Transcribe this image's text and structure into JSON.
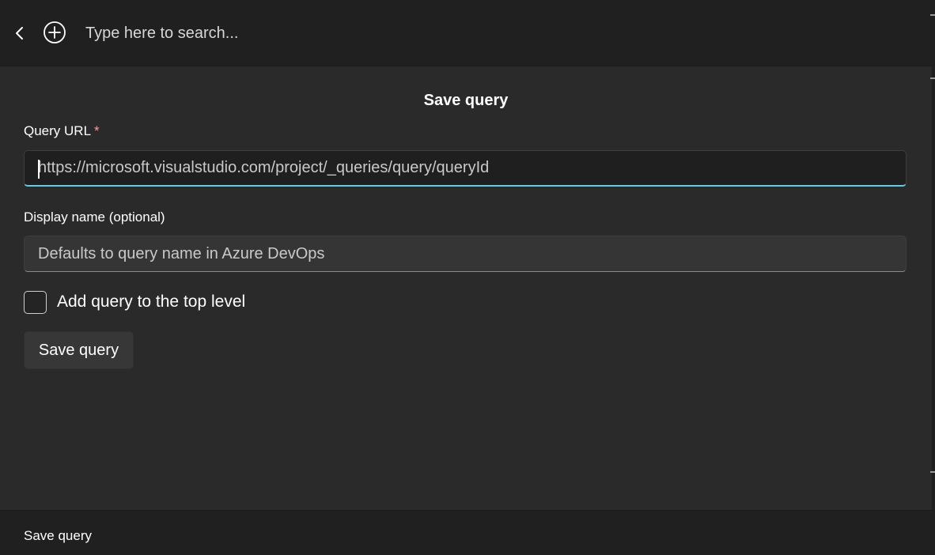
{
  "header": {
    "search_placeholder": "Type here to search..."
  },
  "panel": {
    "title": "Save query",
    "query_url": {
      "label": "Query URL",
      "required_mark": "*",
      "placeholder": "https://microsoft.visualstudio.com/project/_queries/query/queryId"
    },
    "display_name": {
      "label": "Display name (optional)",
      "placeholder": "Defaults to query name in Azure DevOps"
    },
    "top_level_checkbox": {
      "label": "Add query to the top level",
      "checked": false
    },
    "save_button_label": "Save query"
  },
  "footer": {
    "text": "Save query"
  },
  "colors": {
    "accent": "#60cde0",
    "required": "#ff9a9a"
  },
  "icons": {
    "back": "chevron-left-icon",
    "add": "plus-circle-icon"
  }
}
